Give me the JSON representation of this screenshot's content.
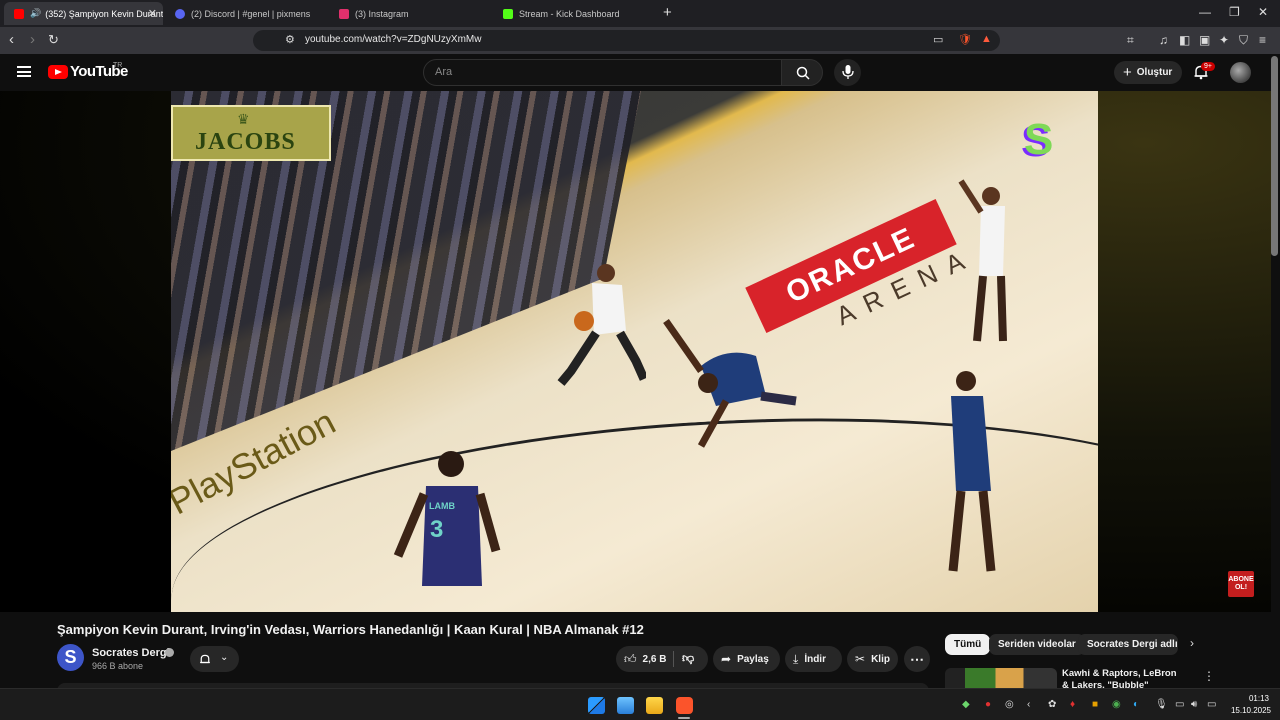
{
  "browser": {
    "tabs": [
      {
        "title": "(352) Şampiyon Kevin Durant",
        "favicon_color": "#ff0000",
        "active": true
      },
      {
        "title": "(2) Discord | #genel | pixmens",
        "favicon_color": "#5865f2",
        "active": false
      },
      {
        "title": "(3) Instagram",
        "favicon_color": "#e1306c",
        "active": false
      },
      {
        "title": "Stream - Kick Dashboard",
        "favicon_color": "#53fc18",
        "active": false
      }
    ],
    "url": "youtube.com/watch?v=ZDgNUzyXmMw"
  },
  "youtube": {
    "logo_text": "YouTube",
    "region": "TR",
    "search_placeholder": "Ara",
    "create_label": "Oluştur",
    "notification_count": "9+"
  },
  "video": {
    "overlay_jacobs": "JACOBS",
    "overlay_oracle": "ORACLE",
    "overlay_arena": "ARENA",
    "overlay_playstation": "PlayStation",
    "channel_logo_letter": "S",
    "jersey_number": "3",
    "jersey_name": "LAMB",
    "subscribe_sticker": "ABONE OL!",
    "title": "Şampiyon Kevin Durant, Irving'in Vedası, Warriors Hanedanlığı | Kaan Kural | NBA Almanak #12"
  },
  "channel": {
    "avatar_letter": "S",
    "name": "Socrates Dergi",
    "subscribers": "966 B abone"
  },
  "actions": {
    "likes": "2,6 B",
    "share": "Paylaş",
    "download": "İndir",
    "clip": "Klip",
    "more": "⋯"
  },
  "related": {
    "chips": [
      "Tümü",
      "Seriden videolar",
      "Socrates Dergi adlı yü"
    ],
    "first_video_title": "Kawhi & Raptors, LeBron & Lakers, \"Bubble\" Dönemi, Yaz"
  },
  "taskbar": {
    "time": "01:13",
    "date": "15.10.2025"
  },
  "colors": {
    "youtube_red": "#ff0000",
    "oracle_red": "#d8232a",
    "page_bg": "#0f0f0f"
  }
}
